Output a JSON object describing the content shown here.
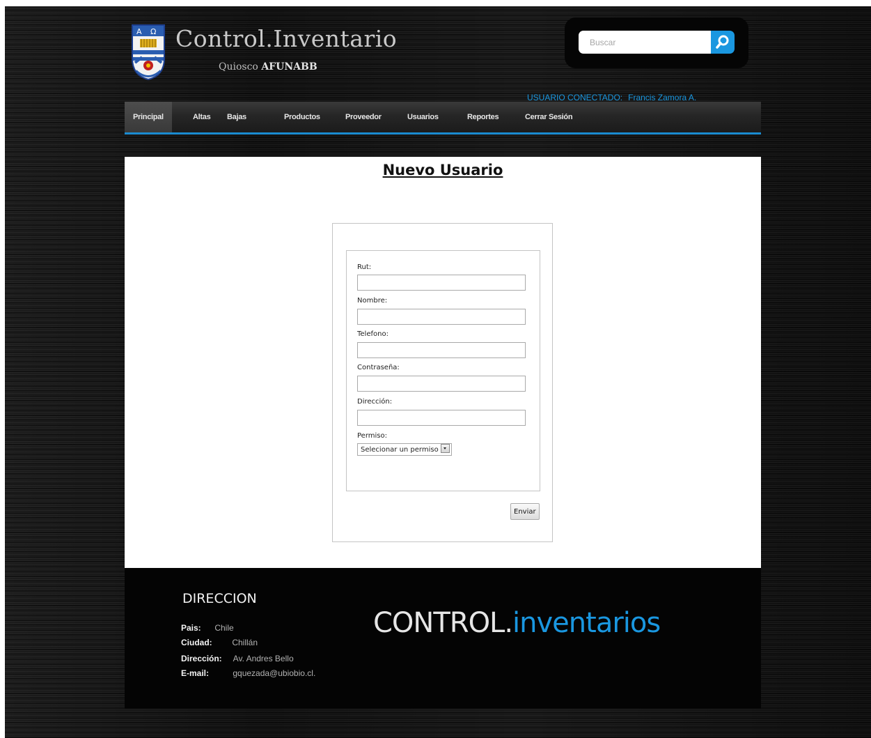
{
  "header": {
    "title": "Control.Inventario",
    "subtitle_prefix": "Quiosco",
    "subtitle_strong": "AFUNABB",
    "search_placeholder": "Buscar",
    "search_icon": "search-icon",
    "user_label": "USUARIO CONECTADO:",
    "user_name": "Francis Zamora A."
  },
  "nav": {
    "items": [
      {
        "label": "Principal"
      },
      {
        "label": "Altas"
      },
      {
        "label": "Bajas"
      },
      {
        "label": "Productos"
      },
      {
        "label": "Proveedor"
      },
      {
        "label": "Usuarios"
      },
      {
        "label": "Reportes"
      },
      {
        "label": "Cerrar Sesión"
      }
    ]
  },
  "form": {
    "title": "Nuevo Usuario",
    "fields": [
      {
        "label": "Rut:",
        "value": ""
      },
      {
        "label": "Nombre:",
        "value": ""
      },
      {
        "label": "Telefono:",
        "value": ""
      },
      {
        "label": "Contraseña:",
        "value": ""
      },
      {
        "label": "Dirección:",
        "value": ""
      }
    ],
    "permiso_label": "Permiso:",
    "permiso_selected": "Selecionar un permiso",
    "submit_label": "Enviar"
  },
  "footer": {
    "heading": "DIRECCION",
    "rows": [
      {
        "key": "Pais:",
        "value": "Chile"
      },
      {
        "key": "Ciudad:",
        "value": "Chillán"
      },
      {
        "key": "Dirección:",
        "value": "Av. Andres Bello"
      },
      {
        "key": "E-mail:",
        "value": "gquezada@ubiobio.cl."
      }
    ],
    "brand_part1": "CONTROL.",
    "brand_part2": "inventarios"
  },
  "colors": {
    "accent": "#1a97e0",
    "background": "#151515",
    "panel": "#ffffff",
    "footer": "#040404"
  }
}
